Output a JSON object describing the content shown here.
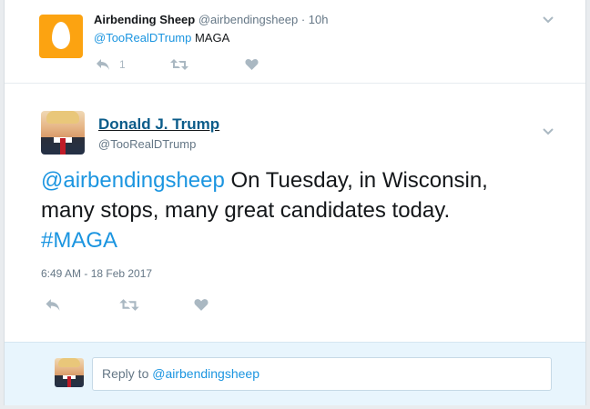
{
  "parent_tweet": {
    "name": "Airbending Sheep",
    "handle": "@airbendingsheep",
    "time": "· 10h",
    "mention": "@TooRealDTrump",
    "text": " MAGA",
    "reply_count": "1"
  },
  "main_tweet": {
    "name": "Donald J. Trump",
    "handle": "@TooRealDTrump",
    "mention": "@airbendingsheep",
    "text_line1": " On Tuesday, in Wisconsin,",
    "text_line2": "many stops, many great candidates today.",
    "hashtag": "#MAGA",
    "timestamp": "6:49 AM - 18 Feb 2017"
  },
  "reply": {
    "prefix": "Reply to ",
    "mention": "@airbendingsheep"
  },
  "colors": {
    "link": "#1b95e0",
    "icon": "#aab8c2",
    "reply_bar": "#e8f5fd"
  },
  "icons": [
    "egg-avatar",
    "reply-icon",
    "retweet-icon",
    "like-icon",
    "chevron-down-icon"
  ]
}
